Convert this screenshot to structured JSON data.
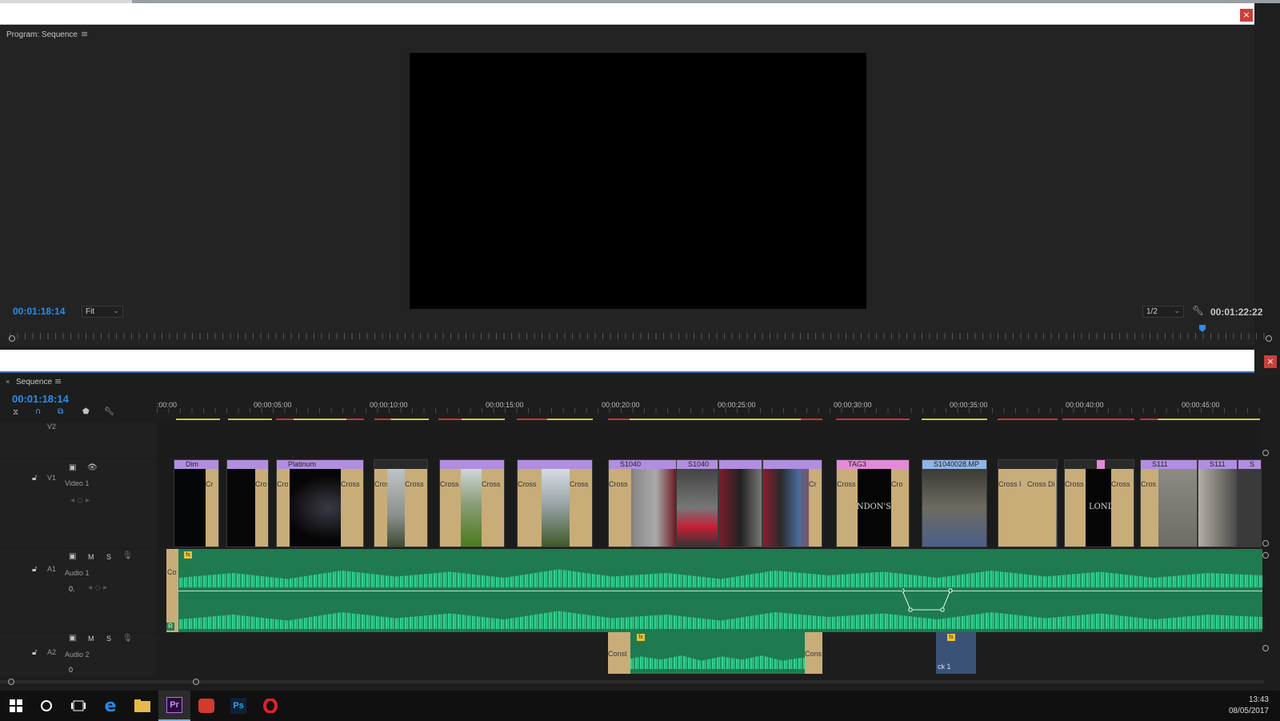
{
  "window": {
    "close_glyph": "×"
  },
  "program_monitor": {
    "title": "Program: Sequence",
    "menu_glyph": "≡",
    "timecode_current": "00:01:18:14",
    "zoom_select": "Fit",
    "resolution_select": "1/2",
    "timecode_duration": "00:01:22:22"
  },
  "timeline": {
    "tab_close": "×",
    "tab_title": "Sequence",
    "timecode": "00:01:18:14",
    "ruler_labels": [
      ":00:00",
      "00:00:05:00",
      "00:00:10:00",
      "00:00:15:00",
      "00:00:20:00",
      "00:00:25:00",
      "00:00:30:00",
      "00:00:35:00",
      "00:00:40:00",
      "00:00:45:00"
    ],
    "tracks": {
      "v2": {
        "id": "V2"
      },
      "v1": {
        "id": "V1",
        "name": "Video 1"
      },
      "a1": {
        "id": "A1",
        "name": "Audio 1",
        "m": "M",
        "s": "S",
        "level": "0."
      },
      "a2": {
        "id": "A2",
        "name": "Audio 2",
        "m": "M",
        "s": "S",
        "level": "0"
      }
    },
    "video_clips": [
      {
        "label": "Dim",
        "trans": "Cr"
      },
      {
        "label": "",
        "trans": "Cro"
      },
      {
        "label": "Platinum",
        "trans_in": "Cro",
        "trans": "Cross"
      },
      {
        "label": "",
        "trans_in": "Cros",
        "trans": "Cross"
      },
      {
        "label": "",
        "trans_in": "Cross",
        "trans": "Cross"
      },
      {
        "label": "",
        "trans_in": "Cross",
        "trans": "Cross"
      },
      {
        "label": "S1040",
        "trans_in": "Cross"
      },
      {
        "label": "S1040",
        "trans": ""
      },
      {
        "label": "",
        "trans": ""
      },
      {
        "label": "",
        "trans": "Cr"
      },
      {
        "label": "TAG3",
        "trans_in": "Cross",
        "trans": "Cro"
      },
      {
        "label": "S1040028.MP",
        "trans": ""
      },
      {
        "label": "",
        "trans_in": "Cross I",
        "trans": "Cross Di"
      },
      {
        "label": "",
        "trans_in": "Cross",
        "trans": "Cross"
      },
      {
        "label": "S111",
        "trans_in": "Cros"
      },
      {
        "label": "S111",
        "trans": ""
      },
      {
        "label": "S",
        "trans": ""
      }
    ],
    "clip_text": {
      "londons1": "LONDON'S MO",
      "londons2": "LONDON"
    },
    "audio_labels": {
      "a1_start": "Co",
      "a1_r": "R",
      "a2_clip_in": "Const",
      "a2_clip_out": "Cons",
      "a2_small": "ck 1"
    }
  },
  "taskbar": {
    "time": "13:43",
    "date": "08/05/2017",
    "apps": [
      "windows-start",
      "cortana",
      "task-view",
      "edge",
      "file-explorer",
      "premiere",
      "creative-cloud",
      "photoshop",
      "opera"
    ],
    "premiere_label": "Pr",
    "photoshop_label": "Ps"
  },
  "colors": {
    "timecode_blue": "#2d8ceb",
    "video_label_purple": "#b18ee0",
    "audio_green": "#1f7a4f",
    "waveform": "#2ed38f",
    "close_red": "#c9403a"
  }
}
